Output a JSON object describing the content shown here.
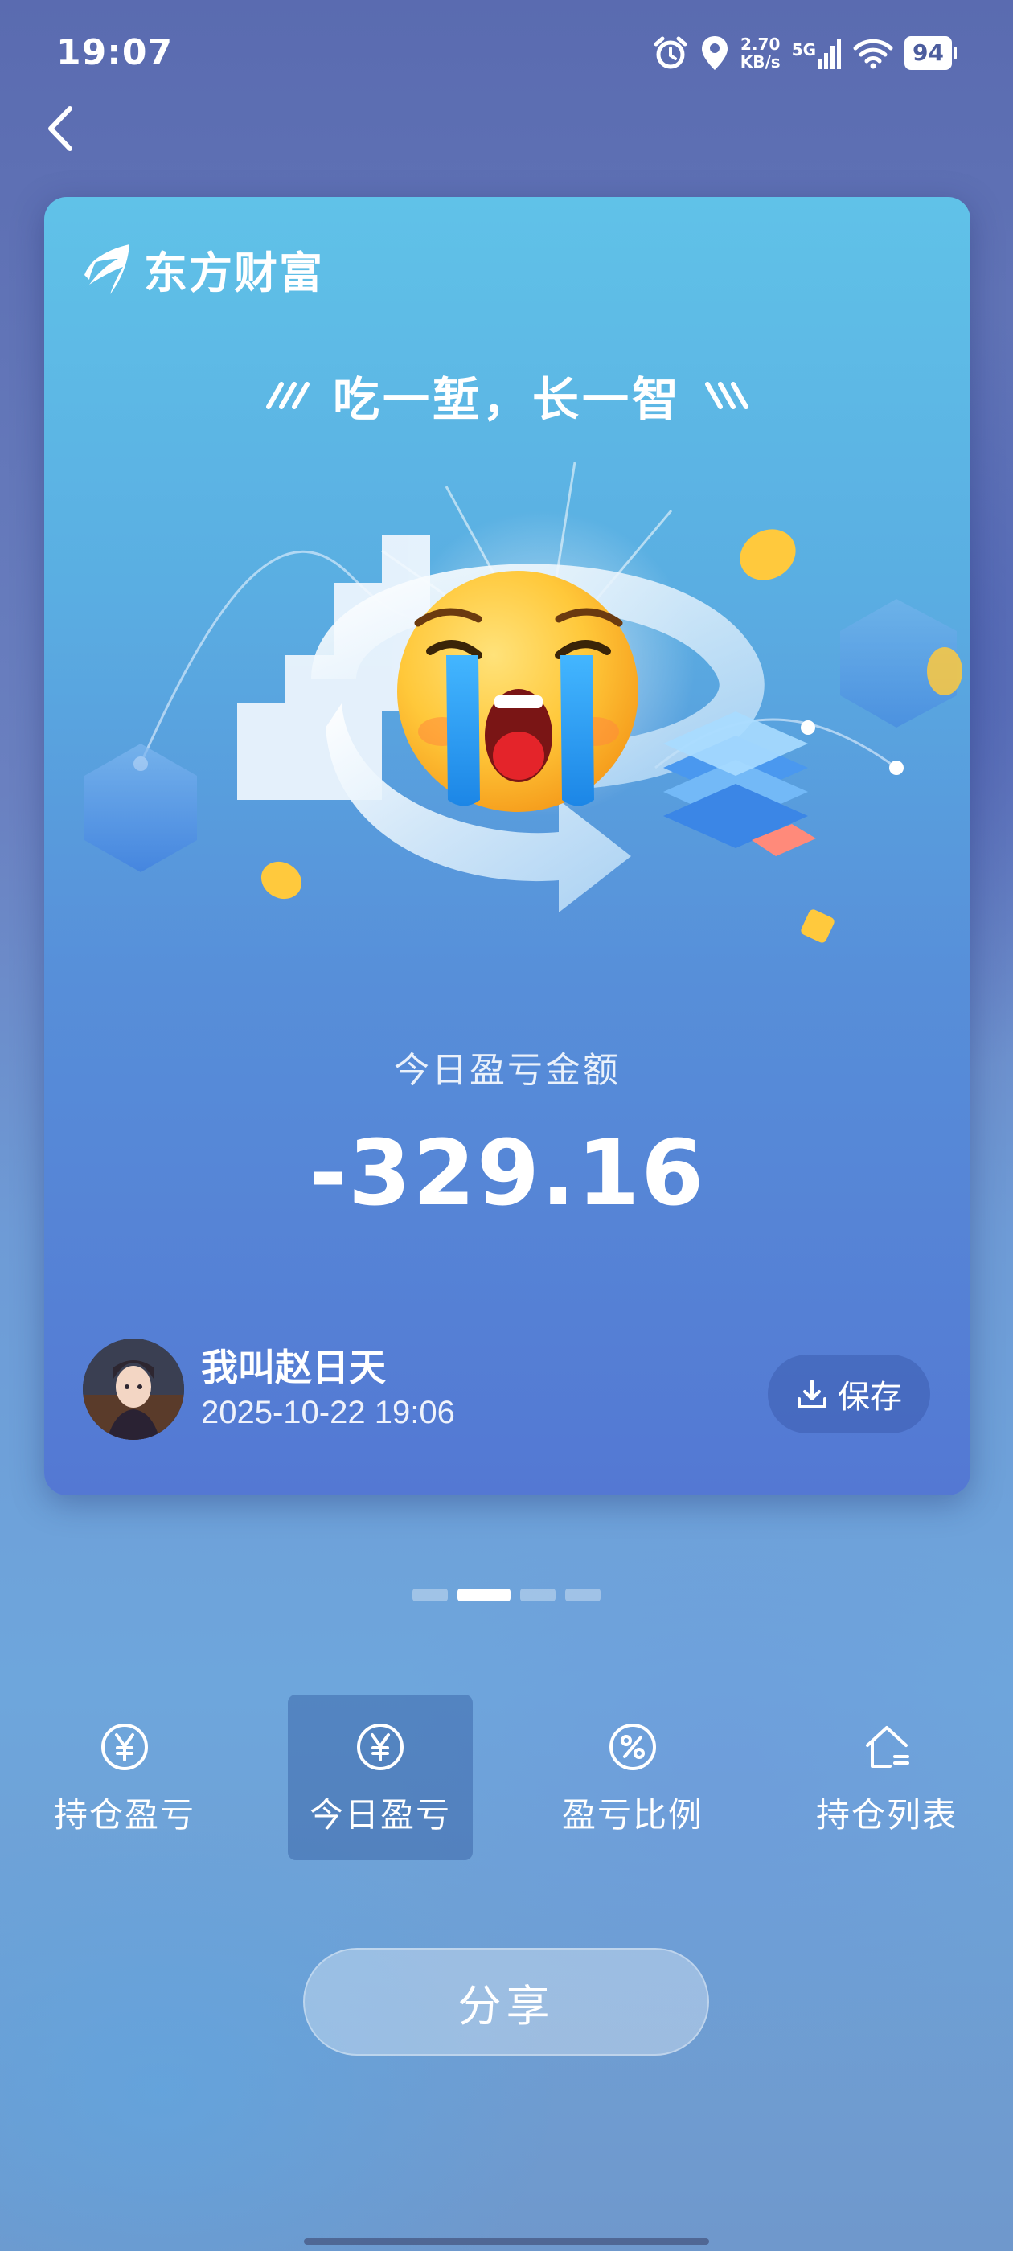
{
  "status_bar": {
    "time": "19:07",
    "net_speed_value": "2.70",
    "net_speed_unit": "KB/s",
    "signal_label": "5G",
    "battery": "94",
    "icons": [
      "alarm-icon",
      "location-icon",
      "signal-icon",
      "wifi-icon",
      "battery-icon"
    ]
  },
  "nav": {
    "back_icon": "chevron-left-icon"
  },
  "card": {
    "brand_name": "东方财富",
    "slogan": "吃一堑，长一智",
    "illustration": "crying-emoji-icon",
    "pnl_label": "今日盈亏金额",
    "pnl_value": "-329.16",
    "user_name": "我叫赵日天",
    "timestamp": "2025-10-22 19:06",
    "save_label": "保存"
  },
  "pager": {
    "count": 4,
    "active_index": 1
  },
  "tabs": [
    {
      "label": "持仓盈亏",
      "icon": "yen-icon",
      "active": false
    },
    {
      "label": "今日盈亏",
      "icon": "yen-icon",
      "active": true
    },
    {
      "label": "盈亏比例",
      "icon": "percent-icon",
      "active": false
    },
    {
      "label": "持仓列表",
      "icon": "home-list-icon",
      "active": false
    }
  ],
  "share_label": "分享",
  "colors": {
    "card_top": "#60c2e8",
    "card_bottom": "#5478d3",
    "active_tab_bg": "#3d6aa6",
    "emoji_yellow": "#ffc83a"
  }
}
